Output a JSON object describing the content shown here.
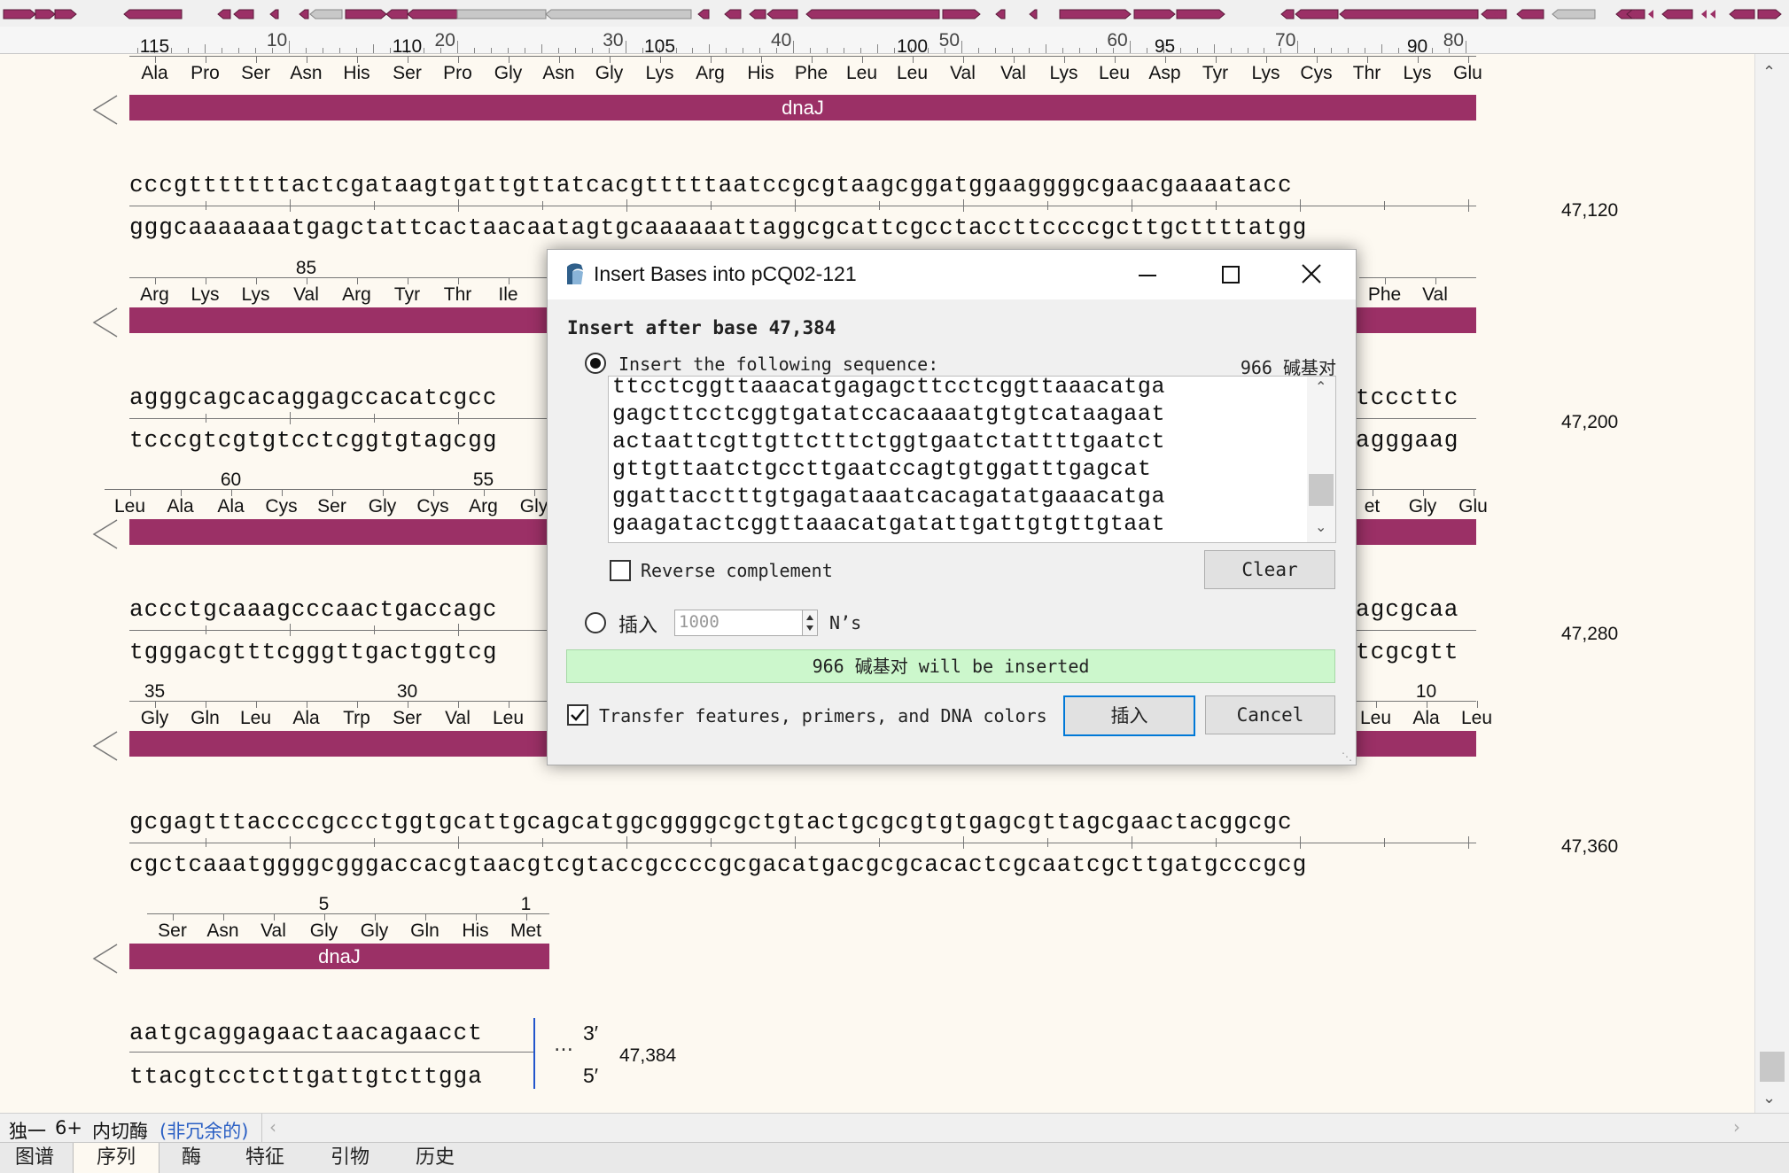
{
  "ruler": {
    "labels": [
      "10",
      "20",
      "30",
      "40",
      "50",
      "60",
      "70",
      "80"
    ]
  },
  "rows": [
    {
      "aa_numbers": [
        "115",
        "110",
        "105",
        "100",
        "95",
        "90"
      ],
      "aa": [
        "Ala",
        "Pro",
        "Ser",
        "Asn",
        "His",
        "Ser",
        "Pro",
        "Gly",
        "Asn",
        "Gly",
        "Lys",
        "Arg",
        "His",
        "Phe",
        "Leu",
        "Leu",
        "Val",
        "Val",
        "Lys",
        "Leu",
        "Asp",
        "Tyr",
        "Lys",
        "Cys",
        "Thr",
        "Lys",
        "Glu"
      ],
      "feature": "dnaJ"
    },
    {
      "top": "cccgtttttttactcgataagtgattgttatcacgtttttaatccgcgtaagcggatggaaggggcgaacgaaaatacc",
      "bottom": "gggcaaaaaaatgagctattcactaacaatagtgcaaaaaattaggcgcattcgcctaccttccccgcttgcttttatgg",
      "pos": "47,120",
      "aa_numbers": [
        "85"
      ],
      "aa_left": [
        "Arg",
        "Lys",
        "Lys",
        "Val",
        "Arg",
        "Tyr",
        "Thr",
        "Ile"
      ],
      "aa_right": [
        "Phe",
        "Val"
      ]
    },
    {
      "top": "agggcagcacaggagccacatcgcc",
      "top_right": "tcccttc",
      "bottom": "tcccgtcgtgtcctcggtgtagcgg",
      "bottom_right": "agggaag",
      "pos": "47,200",
      "aa_numbers": [
        "60",
        "55"
      ],
      "aa_left": [
        "Leu",
        "Ala",
        "Ala",
        "Cys",
        "Ser",
        "Gly",
        "Cys",
        "Arg",
        "Gly"
      ],
      "aa_right": [
        "et",
        "Gly",
        "Glu"
      ]
    },
    {
      "top": "accctgcaaagcccaactgaccagc",
      "top_right": "agcgcaa",
      "bottom": "tgggacgtttcgggttgactggtcg",
      "bottom_right": "tcgcgtt",
      "pos": "47,280",
      "aa_numbers": [
        "35",
        "30"
      ],
      "aa_left": [
        "Gly",
        "Gln",
        "Leu",
        "Ala",
        "Trp",
        "Ser",
        "Val",
        "Leu",
        "L"
      ],
      "aa_right_numbers": [
        "10"
      ],
      "aa_right": [
        "Leu",
        "Ala",
        "Leu"
      ]
    },
    {
      "top": "gcgagtttaccccgccctggtgcattgcagcatggcggggcgctgtactgcgcgtgtgagcgttagcgaactacggcgc",
      "bottom": "cgctcaaatggggcgggaccacgtaacgtcgtaccgccccgcgacatgacgcgcacactcgcaatcgcttgatgcccgcg",
      "pos": "47,360",
      "aa_numbers": [
        "5",
        "1"
      ],
      "aa": [
        "Ser",
        "Asn",
        "Val",
        "Gly",
        "Gly",
        "Gln",
        "His",
        "Met"
      ],
      "feature": "dnaJ"
    },
    {
      "top": "aatgcaggagaactaacagaacct",
      "bottom": "ttacgtcctcttgattgtcttgga",
      "end3": "3′",
      "end5": "5′",
      "ellipsis": "…",
      "pos": "47,384"
    }
  ],
  "status": {
    "unique": "独一",
    "count": "6+",
    "label": "内切酶",
    "nonredundant": "(非冗余的)"
  },
  "tabs": [
    "图谱",
    "序列",
    "酶",
    "特征",
    "引物",
    "历史"
  ],
  "dialog": {
    "title": "Insert Bases into pCQ02-121",
    "insert_after": "Insert after base 47,384",
    "radio_seq_label": "Insert the following sequence:",
    "bp_count": "966 碱基对",
    "sequence_lines": [
      "ttcctcggttaaacatgagagcttcctcggttaaacatga",
      "gagcttcctcggtgatatccacaaaatgtgtcataagaat",
      "actaattcgttgttctttctggtgaatctattttgaatct",
      "gttgttaatctgccttgaatccagtgtggatttgagcat",
      "ggattacctttgtgagataaatcacagatatgaaacatga",
      "gaagatactcggttaaacatgatattgattgtgttgtaat"
    ],
    "reverse_complement": "Reverse complement",
    "clear": "Clear",
    "radio_n_label": "插入",
    "n_value": "1000",
    "n_suffix": "N’s",
    "status": "966 碱基对 will be inserted",
    "transfer": "Transfer features, primers, and DNA colors",
    "insert_btn": "插入",
    "cancel_btn": "Cancel"
  },
  "colors": {
    "feature": "#9b3066",
    "status_bg": "#ccf7cc",
    "accent": "#0078d7",
    "seq_bg": "#fdf9f1"
  }
}
